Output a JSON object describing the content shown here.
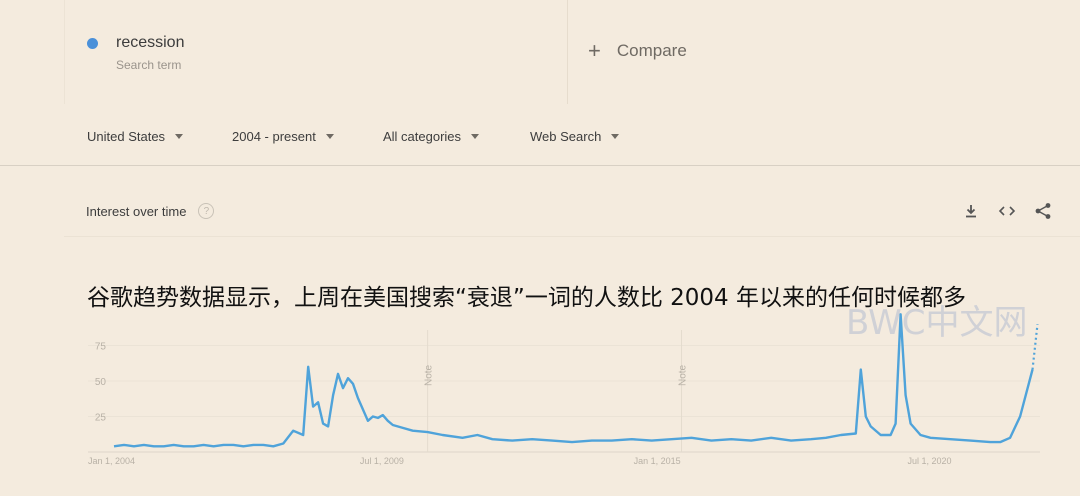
{
  "term": {
    "name": "recession",
    "subtitle": "Search term",
    "color": "#4a90d9"
  },
  "compare": {
    "label": "Compare"
  },
  "filters": {
    "region": "United States",
    "time": "2004 - present",
    "category": "All categories",
    "search_type": "Web Search"
  },
  "panel": {
    "title": "Interest over time",
    "help": "?"
  },
  "overlay": {
    "caption": "谷歌趋势数据显示，上周在美国搜索“衰退”一词的人数比 2004 年以来的任何时候都多",
    "watermark": "BWC中文网"
  },
  "chart_data": {
    "type": "line",
    "title": "",
    "xlabel": "",
    "ylabel": "",
    "x_ticks": [
      "Jan 1, 2004",
      "Jul 1, 2009",
      "Jan 1, 2015",
      "Jul 1, 2020"
    ],
    "y_ticks": [
      25,
      50,
      75
    ],
    "ylim": [
      0,
      100
    ],
    "xlim": [
      2004.0,
      2022.6
    ],
    "annotations": [
      {
        "x": 2010.3,
        "label": "Note"
      },
      {
        "x": 2015.4,
        "label": "Note"
      }
    ],
    "series": [
      {
        "line_color": "#4fa3da",
        "x": [
          2004.0,
          2004.2,
          2004.4,
          2004.6,
          2004.8,
          2005.0,
          2005.2,
          2005.4,
          2005.6,
          2005.8,
          2006.0,
          2006.2,
          2006.4,
          2006.6,
          2006.8,
          2007.0,
          2007.2,
          2007.4,
          2007.6,
          2007.8,
          2007.9,
          2008.0,
          2008.1,
          2008.2,
          2008.3,
          2008.4,
          2008.5,
          2008.6,
          2008.7,
          2008.8,
          2008.9,
          2009.0,
          2009.1,
          2009.2,
          2009.3,
          2009.4,
          2009.5,
          2009.6,
          2009.8,
          2010.0,
          2010.3,
          2010.6,
          2011.0,
          2011.3,
          2011.6,
          2012.0,
          2012.4,
          2012.8,
          2013.2,
          2013.6,
          2014.0,
          2014.4,
          2014.8,
          2015.2,
          2015.6,
          2016.0,
          2016.4,
          2016.8,
          2017.2,
          2017.6,
          2018.0,
          2018.3,
          2018.6,
          2018.9,
          2019.0,
          2019.1,
          2019.2,
          2019.4,
          2019.6,
          2019.7,
          2019.8,
          2019.9,
          2020.0,
          2020.2,
          2020.4,
          2020.8,
          2021.2,
          2021.6,
          2021.8,
          2022.0,
          2022.2,
          2022.45
        ],
        "values": [
          4,
          5,
          4,
          5,
          4,
          4,
          5,
          4,
          4,
          5,
          4,
          5,
          5,
          4,
          5,
          5,
          4,
          6,
          15,
          12,
          60,
          32,
          35,
          20,
          18,
          40,
          55,
          45,
          52,
          48,
          38,
          30,
          22,
          25,
          24,
          26,
          22,
          19,
          17,
          15,
          14,
          12,
          10,
          12,
          9,
          8,
          9,
          8,
          7,
          8,
          8,
          9,
          8,
          9,
          10,
          8,
          9,
          8,
          10,
          8,
          9,
          10,
          12,
          13,
          58,
          25,
          18,
          12,
          12,
          20,
          97,
          40,
          20,
          12,
          10,
          9,
          8,
          7,
          7,
          10,
          25,
          58
        ]
      },
      {
        "line_style": "dotted",
        "x": [
          2022.45,
          2022.55
        ],
        "values": [
          58,
          90
        ]
      }
    ]
  }
}
